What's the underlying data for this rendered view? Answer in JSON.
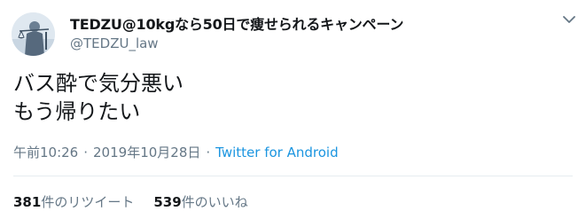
{
  "tweet": {
    "avatar_icon": "scales-of-justice-statue-avatar",
    "display_name": "TEDZU@10kgなら50日で痩せられるキャンペーン",
    "handle": "@TEDZU_law",
    "more_icon": "chevron-down-icon",
    "text_lines": [
      "バス酔で気分悪い",
      "もう帰りたい"
    ],
    "time": "午前10:26",
    "separator": "·",
    "date": "2019年10月28日",
    "source": "Twitter for Android",
    "retweets": {
      "count": "381",
      "label": "件のリツイート"
    },
    "likes": {
      "count": "539",
      "label": "件のいいね"
    }
  },
  "colors": {
    "text": "#14171a",
    "secondary": "#657786",
    "link": "#1b95e0",
    "divider": "#e6ecf0"
  }
}
